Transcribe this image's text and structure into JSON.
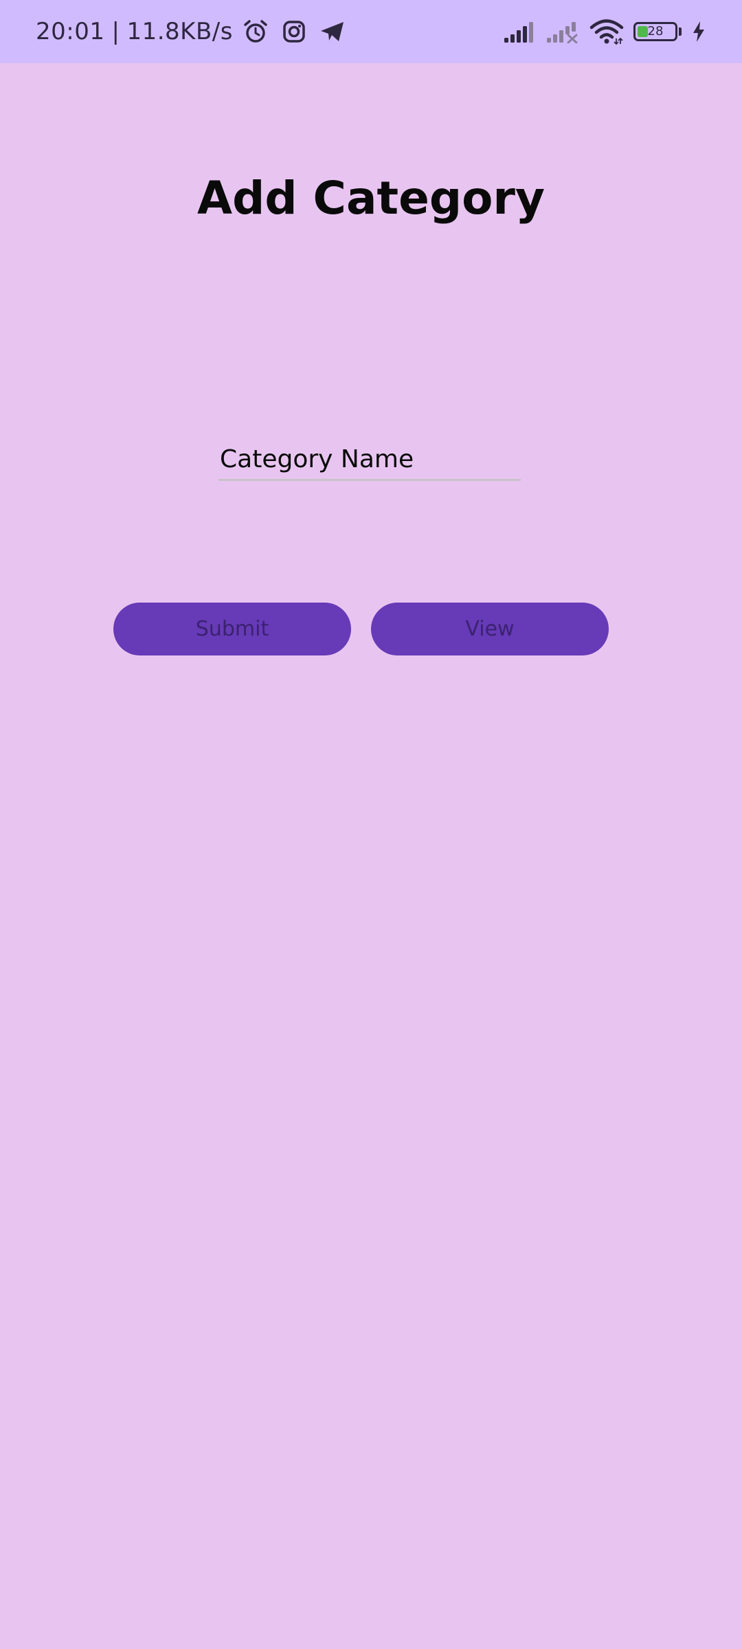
{
  "status_bar": {
    "time": "20:01",
    "separator": "|",
    "network_speed": "11.8KB/s",
    "left_icons": [
      "alarm-icon",
      "instagram-icon",
      "telegram-icon"
    ],
    "right_icons": [
      "signal-icon",
      "signal-no-service-icon",
      "wifi-icon",
      "battery-icon",
      "charging-icon"
    ],
    "battery_level": "28",
    "battery_fraction": 0.28,
    "battery_fill_color": "#4fb84a"
  },
  "page": {
    "title": "Add Category",
    "background_color": "#e8c5f0"
  },
  "form": {
    "category_name": {
      "value": "",
      "placeholder": "Category Name"
    },
    "submit_label": "Submit",
    "view_label": "View",
    "button_color": "#673ab7"
  }
}
